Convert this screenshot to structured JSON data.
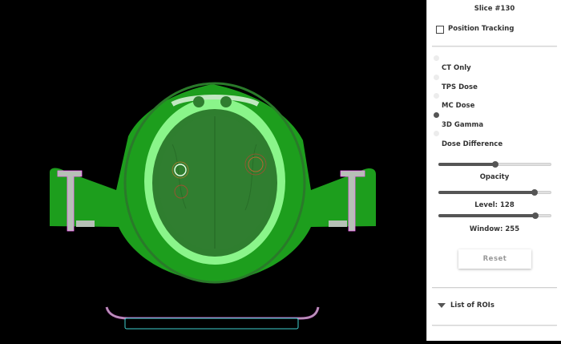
{
  "viewer": {
    "colors": {
      "background": "#000000",
      "dose_green": "#1fa51f",
      "bright_green": "#8ff58f",
      "brain_green": "#2f7d2f",
      "bone": "#b9c3b9"
    }
  },
  "panel": {
    "slice_title": "Slice #130",
    "position_tracking": {
      "label": "Position Tracking",
      "checked": false
    },
    "view_modes": [
      {
        "label": "CT Only",
        "selected": false
      },
      {
        "label": "TPS Dose",
        "selected": false
      },
      {
        "label": "MC Dose",
        "selected": true
      },
      {
        "label": "3D Gamma",
        "selected": false
      },
      {
        "label": "Dose Difference",
        "selected": false
      }
    ],
    "sliders": {
      "opacity": {
        "label": "Opacity",
        "value": 0.5
      },
      "level": {
        "label": "Level: 128",
        "value": 0.85
      },
      "window": {
        "label": "Window: 255",
        "value": 0.86
      }
    },
    "reset_label": "Reset",
    "roi_list_label": "List of ROIs"
  }
}
